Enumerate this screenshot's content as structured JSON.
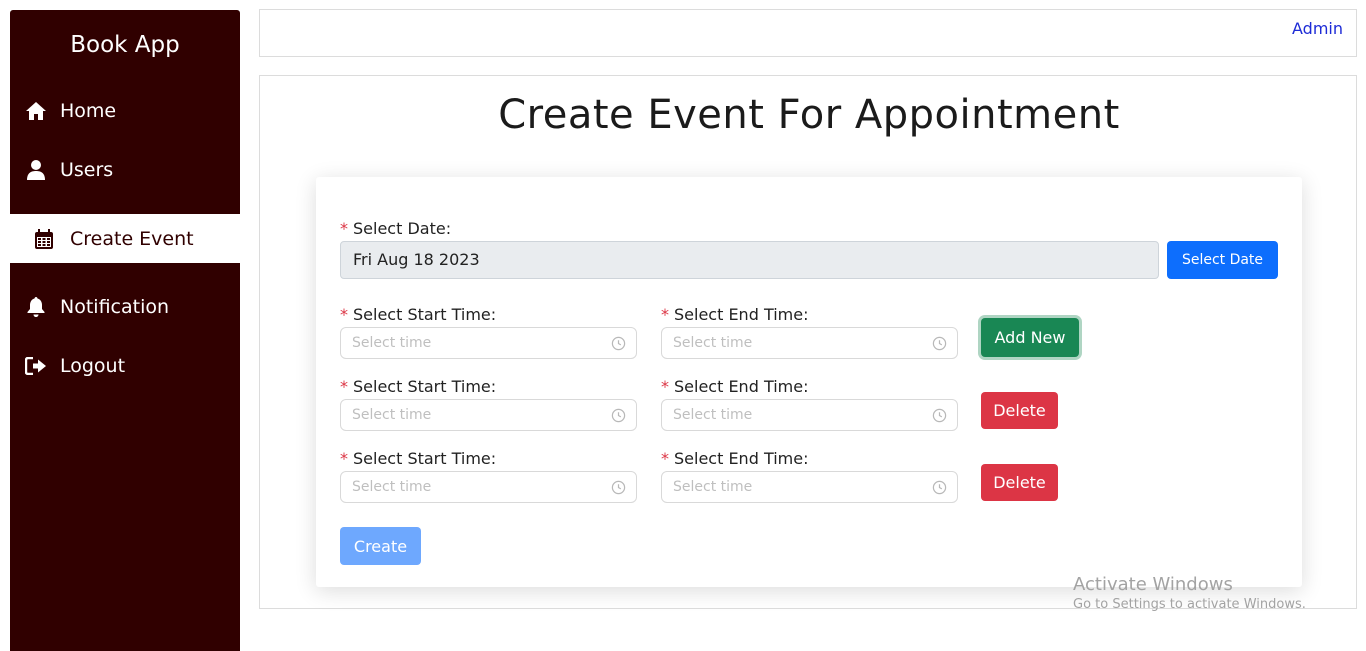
{
  "app": {
    "brand": "Book App"
  },
  "sidebar": {
    "items": [
      {
        "label": "Home",
        "icon": "home-icon"
      },
      {
        "label": "Users",
        "icon": "user-icon"
      },
      {
        "label": "Create Event",
        "icon": "calendar-icon",
        "active": true
      },
      {
        "label": "Notification",
        "icon": "bell-icon"
      },
      {
        "label": "Logout",
        "icon": "logout-icon"
      }
    ]
  },
  "topbar": {
    "user_link": "Admin"
  },
  "main": {
    "title": "Create Event For Appointment"
  },
  "form": {
    "required_mark": "*",
    "date_label": "Select Date:",
    "date_value": "Fri Aug 18 2023",
    "select_date_button": "Select Date",
    "start_time_label": "Select Start Time:",
    "end_time_label": "Select End Time:",
    "time_placeholder": "Select time",
    "add_new_button": "Add New",
    "delete_button": "Delete",
    "create_button": "Create"
  },
  "colors": {
    "sidebar_bg": "#300000",
    "primary": "#0d6efd",
    "success": "#198754",
    "danger": "#dc3545",
    "primary_disabled": "#6ea8fe"
  },
  "watermark": {
    "line1": "Activate Windows",
    "line2": "Go to Settings to activate Windows."
  }
}
